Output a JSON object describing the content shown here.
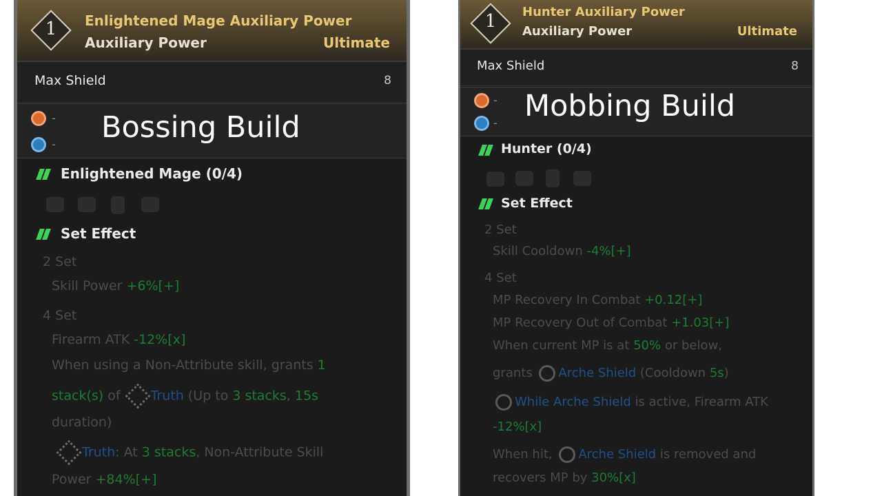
{
  "left": {
    "rank": "1",
    "title": "Enlightened Mage Auxiliary Power",
    "subtitle": "Auxiliary Power",
    "grade": "Ultimate",
    "stat": {
      "label": "Max Shield",
      "value": "8"
    },
    "sockets": [
      {
        "dash": "-"
      },
      {
        "dash": "-"
      }
    ],
    "overlay": "Bossing Build",
    "set_name": "Enlightened Mage (0/4)",
    "set_effect_title": "Set Effect",
    "set2_title": "2 Set",
    "set2_line": {
      "text": "Skill Power ",
      "value": "+6%[+]"
    },
    "set4_title": "4 Set",
    "set4_firearm": {
      "text": "Firearm ATK ",
      "value": "-12%[x]"
    },
    "set4_desc_a": "When using a Non-Attribute skill, grants ",
    "set4_desc_a_val": "1",
    "set4_desc_b_val": "stack(s)",
    "set4_desc_b_of": " of ",
    "set4_desc_b_truth": "Truth",
    "set4_desc_b_rest1": " (Up to ",
    "set4_desc_b_stacks": "3 stacks",
    "set4_desc_b_comma": ", ",
    "set4_desc_b_dur": "15s",
    "set4_desc_c": "duration)",
    "truth_line": {
      "name": "Truth",
      "mid": ": At ",
      "stacks": "3 stacks",
      "rest": ", Non-Attribute Skill"
    },
    "truth_power": {
      "text": "Power ",
      "value": "+84%[+]"
    }
  },
  "right": {
    "rank": "1",
    "title": "Hunter Auxiliary Power",
    "subtitle": "Auxiliary Power",
    "grade": "Ultimate",
    "stat": {
      "label": "Max Shield",
      "value": "8"
    },
    "sockets": [
      {
        "dash": "-"
      },
      {
        "dash": "-"
      }
    ],
    "overlay": "Mobbing Build",
    "set_name": "Hunter (0/4)",
    "set_effect_title": "Set Effect",
    "set2_title": "2 Set",
    "set2_line": {
      "text": "Skill Cooldown ",
      "value": "-4%[+]"
    },
    "set4_title": "4 Set",
    "mp_in": {
      "text": "MP Recovery In Combat ",
      "value": "+0.12[+]"
    },
    "mp_out": {
      "text": "MP Recovery Out of Combat ",
      "value": "+1.03[+]"
    },
    "mp_cond": {
      "text": "When current MP is at ",
      "value": "50%",
      "rest": " or below,"
    },
    "grants": {
      "text": "grants ",
      "shield": "Arche Shield",
      "cd_open": " (Cooldown ",
      "cd": "5s",
      "cd_close": ")"
    },
    "while": {
      "shield": "While Arche Shield",
      "rest": " is active, Firearm ATK"
    },
    "while_val": "-12%[x]",
    "hit": {
      "text": "When hit, ",
      "shield": "Arche Shield",
      "rest": " is removed and"
    },
    "recover": {
      "text": "recovers MP by ",
      "value": "30%[x]"
    }
  }
}
